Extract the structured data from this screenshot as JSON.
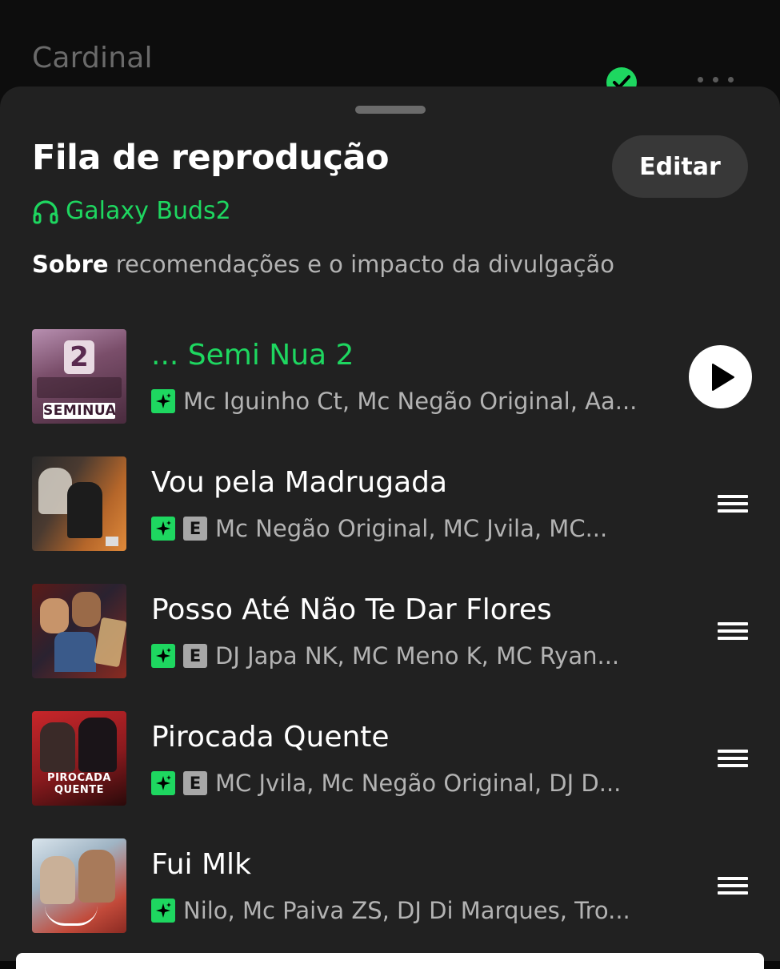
{
  "background": {
    "title": "Cardinal"
  },
  "queue": {
    "title": "Fila de reprodução",
    "edit_label": "Editar",
    "device": "Galaxy Buds2",
    "about_bold": "Sobre",
    "about_rest": " recomendações e o impacto da divulgação"
  },
  "tracks": [
    {
      "title": "... Semi Nua 2",
      "artists": "Mc Iguinho Ct, Mc Negão Original, Aa...",
      "explicit": false,
      "playing": true,
      "cover_text": "SEMINUA"
    },
    {
      "title": "Vou pela Madrugada",
      "artists": "Mc Negão Original, MC Jvila, MC...",
      "explicit": true,
      "playing": false,
      "cover_text": ""
    },
    {
      "title": "Posso Até Não Te Dar Flores",
      "artists": "DJ Japa NK, MC Meno K, MC Ryan...",
      "explicit": true,
      "playing": false,
      "cover_text": ""
    },
    {
      "title": "Pirocada Quente",
      "artists": "MC Jvila, Mc Negão Original, DJ D...",
      "explicit": true,
      "playing": false,
      "cover_text": "PIROCADA QUENTE"
    },
    {
      "title": "Fui Mlk",
      "artists": "Nilo, Mc Paiva ZS, DJ Di Marques, Tro...",
      "explicit": false,
      "playing": false,
      "cover_text": ""
    }
  ],
  "explicit_label": "E",
  "colors": {
    "accent": "#1ed760",
    "sheet": "#212121",
    "muted": "#b3b3b3"
  }
}
